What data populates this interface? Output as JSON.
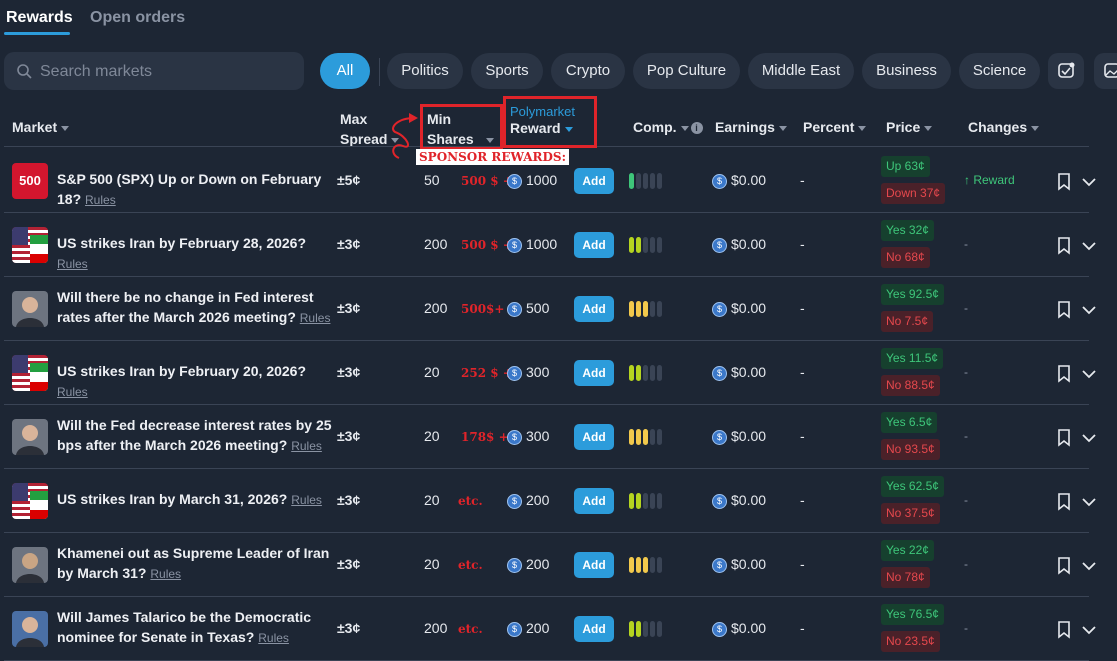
{
  "tabs": {
    "active": "Rewards",
    "other": "Open orders"
  },
  "search": {
    "placeholder": "Search markets"
  },
  "chips": [
    "All",
    "Politics",
    "Sports",
    "Crypto",
    "Pop Culture",
    "Middle East",
    "Business",
    "Science"
  ],
  "columns": {
    "market": "Market",
    "max_spread_1": "Max",
    "max_spread_2": "Spread",
    "min_shares_1": "Min",
    "min_shares_2": "Shares",
    "poly_label": "Polymarket",
    "reward": "Reward",
    "comp": "Comp.",
    "earnings": "Earnings",
    "percent": "Percent",
    "price": "Price",
    "changes": "Changes"
  },
  "annotation": {
    "sponsor": "SPONSOR REWARDS:"
  },
  "colors": {
    "accent": "#2c9cdb",
    "yes": "#3ec67a",
    "no": "#e5484d",
    "annotation": "#e0242a"
  },
  "rows": [
    {
      "title": "S&P 500 (SPX) Up or Down on February 18?",
      "rules": "Rules",
      "thumb": "500",
      "spread": "±5¢",
      "min": "50",
      "sponsor": "500 $ +",
      "reward": "1000",
      "add": "Add",
      "comp_filled": 1,
      "comp_color": "#3ec67a",
      "earn": "$0.00",
      "pct": "-",
      "yes": "Up 63¢",
      "no": "Down 37¢",
      "change": "↑ Reward"
    },
    {
      "title": "US strikes Iran by February 28, 2026?",
      "rules": "Rules",
      "thumb": "flag",
      "spread": "±3¢",
      "min": "200",
      "sponsor": "500 $ +",
      "reward": "1000",
      "add": "Add",
      "comp_filled": 2,
      "comp_color": "#b5d420",
      "earn": "$0.00",
      "pct": "-",
      "yes": "Yes 32¢",
      "no": "No 68¢",
      "change": "-"
    },
    {
      "title": "Will there be no change in Fed interest rates after the March 2026 meeting?",
      "rules": "Rules",
      "thumb": "person",
      "spread": "±3¢",
      "min": "200",
      "sponsor": "500$+",
      "reward": "500",
      "add": "Add",
      "comp_filled": 3,
      "comp_color": "#f2c94c",
      "earn": "$0.00",
      "pct": "-",
      "yes": "Yes 92.5¢",
      "no": "No 7.5¢",
      "change": "-"
    },
    {
      "title": "US strikes Iran by February 20, 2026?",
      "rules": "Rules",
      "thumb": "flag",
      "spread": "±3¢",
      "min": "20",
      "sponsor": "252 $ +",
      "reward": "300",
      "add": "Add",
      "comp_filled": 2,
      "comp_color": "#b5d420",
      "earn": "$0.00",
      "pct": "-",
      "yes": "Yes 11.5¢",
      "no": "No 88.5¢",
      "change": "-"
    },
    {
      "title": "Will the Fed decrease interest rates by 25 bps after the March 2026 meeting?",
      "rules": "Rules",
      "thumb": "person",
      "spread": "±3¢",
      "min": "20",
      "sponsor": "178$ +",
      "reward": "300",
      "add": "Add",
      "comp_filled": 3,
      "comp_color": "#f2c94c",
      "earn": "$0.00",
      "pct": "-",
      "yes": "Yes 6.5¢",
      "no": "No 93.5¢",
      "change": "-"
    },
    {
      "title": "US strikes Iran by March 31, 2026?",
      "rules": "Rules",
      "thumb": "flag",
      "spread": "±3¢",
      "min": "20",
      "sponsor": "etc.",
      "reward": "200",
      "add": "Add",
      "comp_filled": 2,
      "comp_color": "#b5d420",
      "earn": "$0.00",
      "pct": "-",
      "yes": "Yes 62.5¢",
      "no": "No 37.5¢",
      "change": "-"
    },
    {
      "title": "Khamenei out as Supreme Leader of Iran by March 31?",
      "rules": "Rules",
      "thumb": "person2",
      "spread": "±3¢",
      "min": "20",
      "sponsor": "etc.",
      "reward": "200",
      "add": "Add",
      "comp_filled": 3,
      "comp_color": "#f2c94c",
      "earn": "$0.00",
      "pct": "-",
      "yes": "Yes 22¢",
      "no": "No 78¢",
      "change": "-"
    },
    {
      "title": "Will James Talarico be the Democratic nominee for Senate in Texas?",
      "rules": "Rules",
      "thumb": "person3",
      "spread": "±3¢",
      "min": "200",
      "sponsor": "etc.",
      "reward": "200",
      "add": "Add",
      "comp_filled": 2,
      "comp_color": "#b5d420",
      "earn": "$0.00",
      "pct": "-",
      "yes": "Yes 76.5¢",
      "no": "No 23.5¢",
      "change": "-"
    }
  ]
}
